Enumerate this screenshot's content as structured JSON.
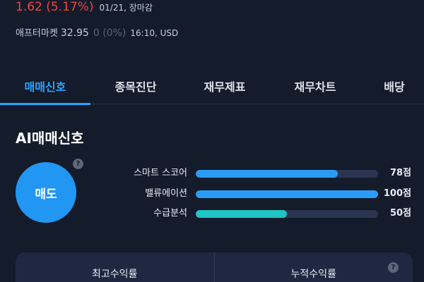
{
  "price": {
    "change": "1.62 (5.17%)",
    "meta": "01/21, 장마감"
  },
  "after_market": {
    "label": "애프터마켓",
    "price": "32.95",
    "change": "0 (0%)",
    "meta": "16:10, USD"
  },
  "tabs": [
    {
      "label": "매매신호",
      "active": true
    },
    {
      "label": "종목진단",
      "active": false
    },
    {
      "label": "재무제표",
      "active": false
    },
    {
      "label": "재무차트",
      "active": false
    },
    {
      "label": "배당",
      "active": false
    }
  ],
  "ai_signal": {
    "title": "AI매매신호",
    "signal": "매도",
    "help_glyph": "?",
    "metrics": [
      {
        "label": "스마트 스코어",
        "value": "78점",
        "level": 78,
        "color": "#2a9cf7"
      },
      {
        "label": "밸류에이션",
        "value": "100점",
        "level": 100,
        "color": "#2a9cf7"
      },
      {
        "label": "수급분석",
        "value": "50점",
        "level": 50,
        "color": "#1fc4c4"
      }
    ]
  },
  "returns": {
    "max_label": "최고수익률",
    "cumulative_label": "누적수익률"
  },
  "colors": {
    "background": "#141b2b",
    "accent": "#2ba4ff",
    "price_up": "#f0453d"
  }
}
